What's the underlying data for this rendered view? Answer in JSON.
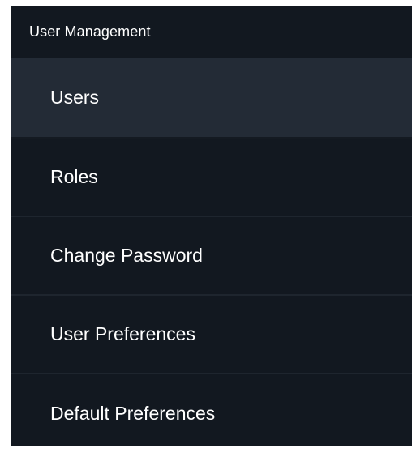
{
  "menu": {
    "title": "User Management",
    "items": [
      {
        "label": "Users",
        "active": true
      },
      {
        "label": "Roles",
        "active": false
      },
      {
        "label": "Change Password",
        "active": false
      },
      {
        "label": "User Preferences",
        "active": false
      },
      {
        "label": "Default Preferences",
        "active": false
      }
    ]
  },
  "colors": {
    "panel_background": "#121820",
    "active_item_background": "#232b36",
    "divider": "#1e252e",
    "text": "#ffffff"
  }
}
